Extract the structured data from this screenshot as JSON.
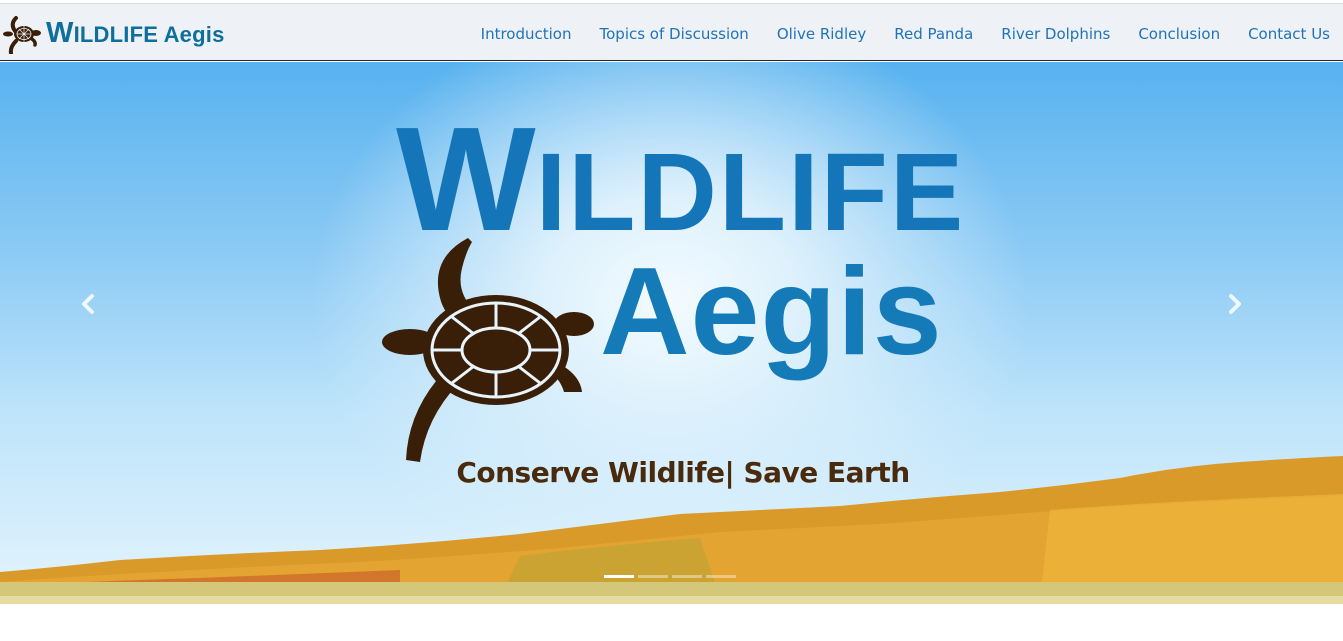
{
  "brand": {
    "name_first_letter": "W",
    "name_rest": "ILDLIFE",
    "name_second": "Aegis",
    "icon": "turtle-icon"
  },
  "nav": {
    "items": [
      {
        "label": "Introduction"
      },
      {
        "label": "Topics of Discussion"
      },
      {
        "label": "Olive Ridley"
      },
      {
        "label": "Red Panda"
      },
      {
        "label": "River Dolphins"
      },
      {
        "label": "Conclusion"
      },
      {
        "label": "Contact Us"
      }
    ]
  },
  "hero": {
    "title_first_letter": "W",
    "title_rest": "ILDLIFE",
    "subtitle": "Aegis",
    "tagline": "Conserve Wildlife| Save Earth",
    "prev_icon": "chevron-left-icon",
    "next_icon": "chevron-right-icon",
    "slide_count": 4,
    "active_slide": 1
  },
  "colors": {
    "brand": "#0f6f9c",
    "nav_link": "#1f74b8",
    "tagline": "#4a2a0c",
    "turtle": "#3a1f08"
  }
}
